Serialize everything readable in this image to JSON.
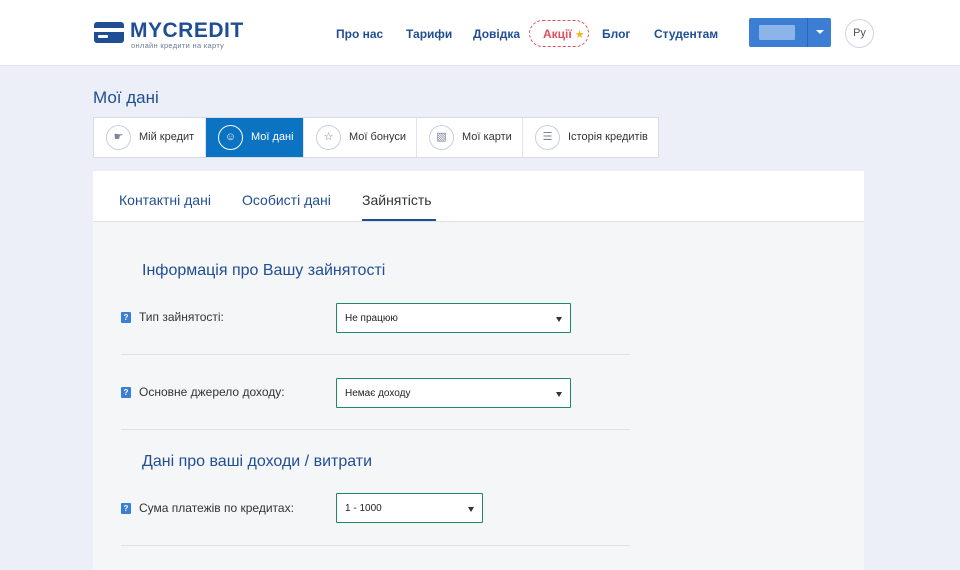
{
  "header": {
    "logo_text": "MYCREDIT",
    "logo_sub": "онлайн кредити на карту",
    "nav": [
      {
        "label": "Про нас"
      },
      {
        "label": "Тарифи"
      },
      {
        "label": "Довідка"
      },
      {
        "label": "Акції"
      },
      {
        "label": "Блог"
      },
      {
        "label": "Студентам"
      }
    ],
    "promo_icon": "star-icon",
    "lang_label": "Ру",
    "colors": {
      "brand": "#1f4e94",
      "accent": "#0b73c2",
      "promo": "#e0505a"
    }
  },
  "page": {
    "title": "Мої дані"
  },
  "tabs": [
    {
      "label": "Мій кредит",
      "icon": "thumb-up-icon",
      "active": false
    },
    {
      "label": "Мої дані",
      "icon": "user-icon",
      "active": true
    },
    {
      "label": "Мої бонуси",
      "icon": "star-icon",
      "active": false
    },
    {
      "label": "Мої карти",
      "icon": "card-icon",
      "active": false
    },
    {
      "label": "Історія кредитів",
      "icon": "list-icon",
      "active": false
    }
  ],
  "subtabs": [
    {
      "label": "Контактні дані",
      "active": false
    },
    {
      "label": "Особисті дані",
      "active": false
    },
    {
      "label": "Зайнятість",
      "active": true
    }
  ],
  "sections": {
    "employment_title": "Інформація про Вашу зайнятості",
    "income_title": "Дані про ваші доходи / витрати"
  },
  "fields": {
    "employment_type": {
      "label": "Тип зайнятості:",
      "value": "Не працюю"
    },
    "income_source": {
      "label": "Основне джерело доходу:",
      "value": "Немає доходу"
    },
    "loan_payments": {
      "label": "Сума платежів по кредитах:",
      "value": "1 - 1000"
    },
    "help_glyph": "?"
  }
}
